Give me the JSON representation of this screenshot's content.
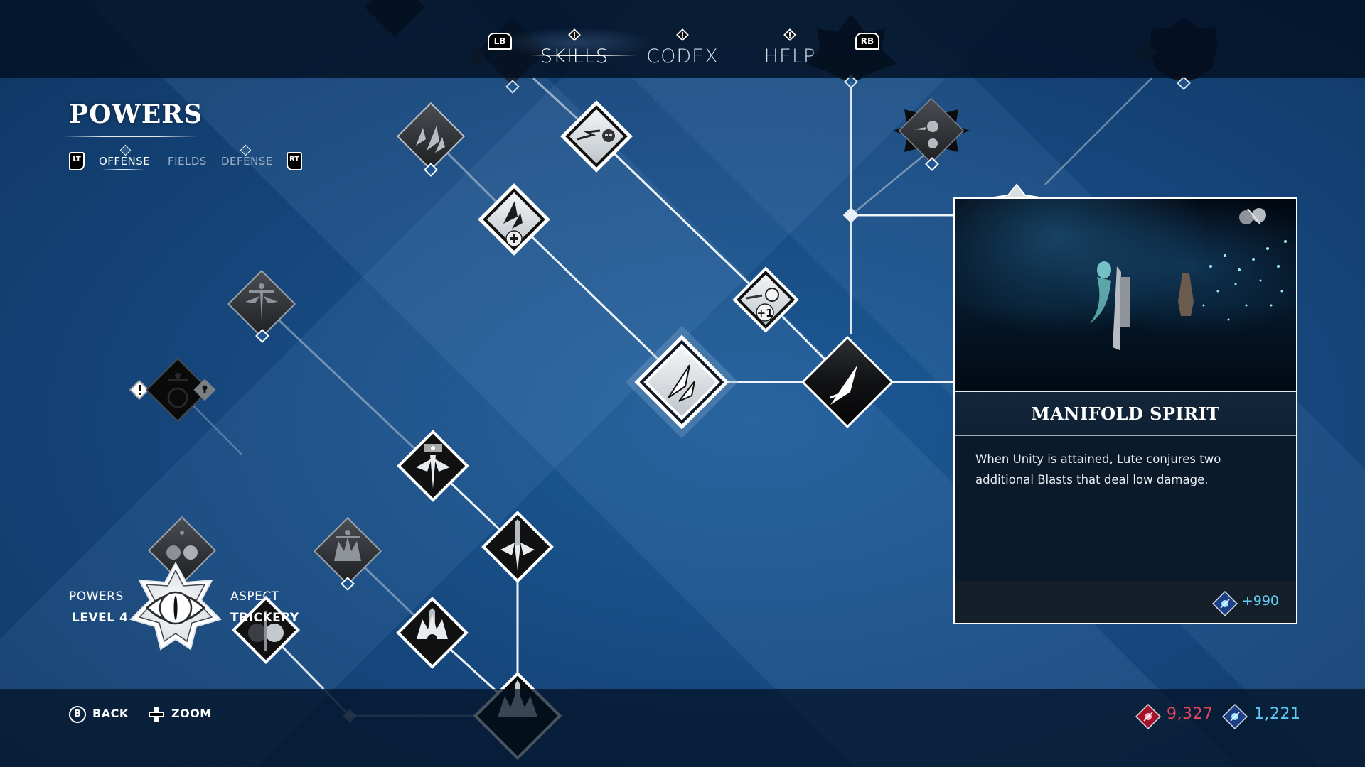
{
  "header": {
    "tabs": [
      {
        "label": "SKILLS",
        "active": true,
        "alert": true
      },
      {
        "label": "CODEX",
        "active": false,
        "alert": true
      },
      {
        "label": "HELP",
        "active": false,
        "alert": true
      }
    ],
    "prev_bumper": "LB",
    "next_bumper": "RB"
  },
  "section": {
    "title": "POWERS",
    "prev_trigger": "LT",
    "next_trigger": "RT",
    "subtabs": [
      {
        "label": "OFFENSE",
        "active": true,
        "alert": true
      },
      {
        "label": "FIELDS",
        "active": false,
        "alert": false
      },
      {
        "label": "DEFENSE",
        "active": false,
        "alert": true
      }
    ]
  },
  "status": {
    "powers_label": "POWERS",
    "level_label": "LEVEL 4",
    "aspect_label": "ASPECT",
    "aspect_value": "TRICKERY"
  },
  "skill_tree": {
    "nodes": [
      {
        "id": "ghost-top-left",
        "icon": "locked-skull-icon",
        "state": "hidden"
      },
      {
        "id": "ghost-lb",
        "icon": "skull-emblem-icon",
        "state": "hidden"
      },
      {
        "id": "triple-rockets",
        "icon": "triple-rockets-icon",
        "state": "available"
      },
      {
        "id": "skull-lightning",
        "icon": "skull-lightning-icon",
        "state": "unlocked"
      },
      {
        "id": "rockets-plus",
        "icon": "rockets-plus-icon",
        "state": "unlocked"
      },
      {
        "id": "skull-plus-one",
        "icon": "skull-plus-one-icon",
        "state": "unlocked",
        "badge": "+1"
      },
      {
        "id": "manifold-spirit",
        "icon": "twin-rockets-icon",
        "state": "selected"
      },
      {
        "id": "blast-core",
        "icon": "rocket-icon",
        "state": "core"
      },
      {
        "id": "ghost-rb",
        "icon": "skull-star-icon",
        "state": "hidden"
      },
      {
        "id": "star-skull",
        "icon": "star-skull-icon",
        "state": "available"
      },
      {
        "id": "ghost-top-right",
        "icon": "spire-star-icon",
        "state": "hidden"
      },
      {
        "id": "dark-fan",
        "icon": "spirit-fan-icon",
        "state": "available"
      },
      {
        "id": "locked-fan",
        "icon": "spirit-circle-icon",
        "state": "locked"
      },
      {
        "id": "light-fan",
        "icon": "spirit-fan-icon",
        "state": "unlocked"
      },
      {
        "id": "dark-crown",
        "icon": "spirit-crown-icon",
        "state": "available"
      },
      {
        "id": "light-fan-right",
        "icon": "spirit-spire-icon",
        "state": "unlocked"
      },
      {
        "id": "light-crown",
        "icon": "spirit-crown-icon",
        "state": "unlocked"
      },
      {
        "id": "ghost-bottom",
        "icon": "spire-crown-icon",
        "state": "hidden"
      },
      {
        "id": "hidden-right",
        "icon": "spire-icon",
        "state": "hidden"
      }
    ]
  },
  "detail_panel": {
    "title": "MANIFOLD SPIRIT",
    "description": "When Unity is attained, Lute conjures two additional Blasts that deal low damage.",
    "cost": "+990",
    "cost_currency": "blue-shard-icon",
    "preview_badge_icon": "aspect-swap-icon"
  },
  "footer": {
    "back_button": "B",
    "back_label": "BACK",
    "zoom_label": "ZOOM"
  },
  "currencies": [
    {
      "name": "red-shards",
      "value": "9,327",
      "color": "#e8455a"
    },
    {
      "name": "blue-shards",
      "value": "1,221",
      "color": "#5fc8f2"
    }
  ],
  "colors": {
    "background": "#174a7e",
    "bar": "#031022",
    "accent_blue": "#5fd0f5",
    "accent_red": "#e8455a"
  }
}
